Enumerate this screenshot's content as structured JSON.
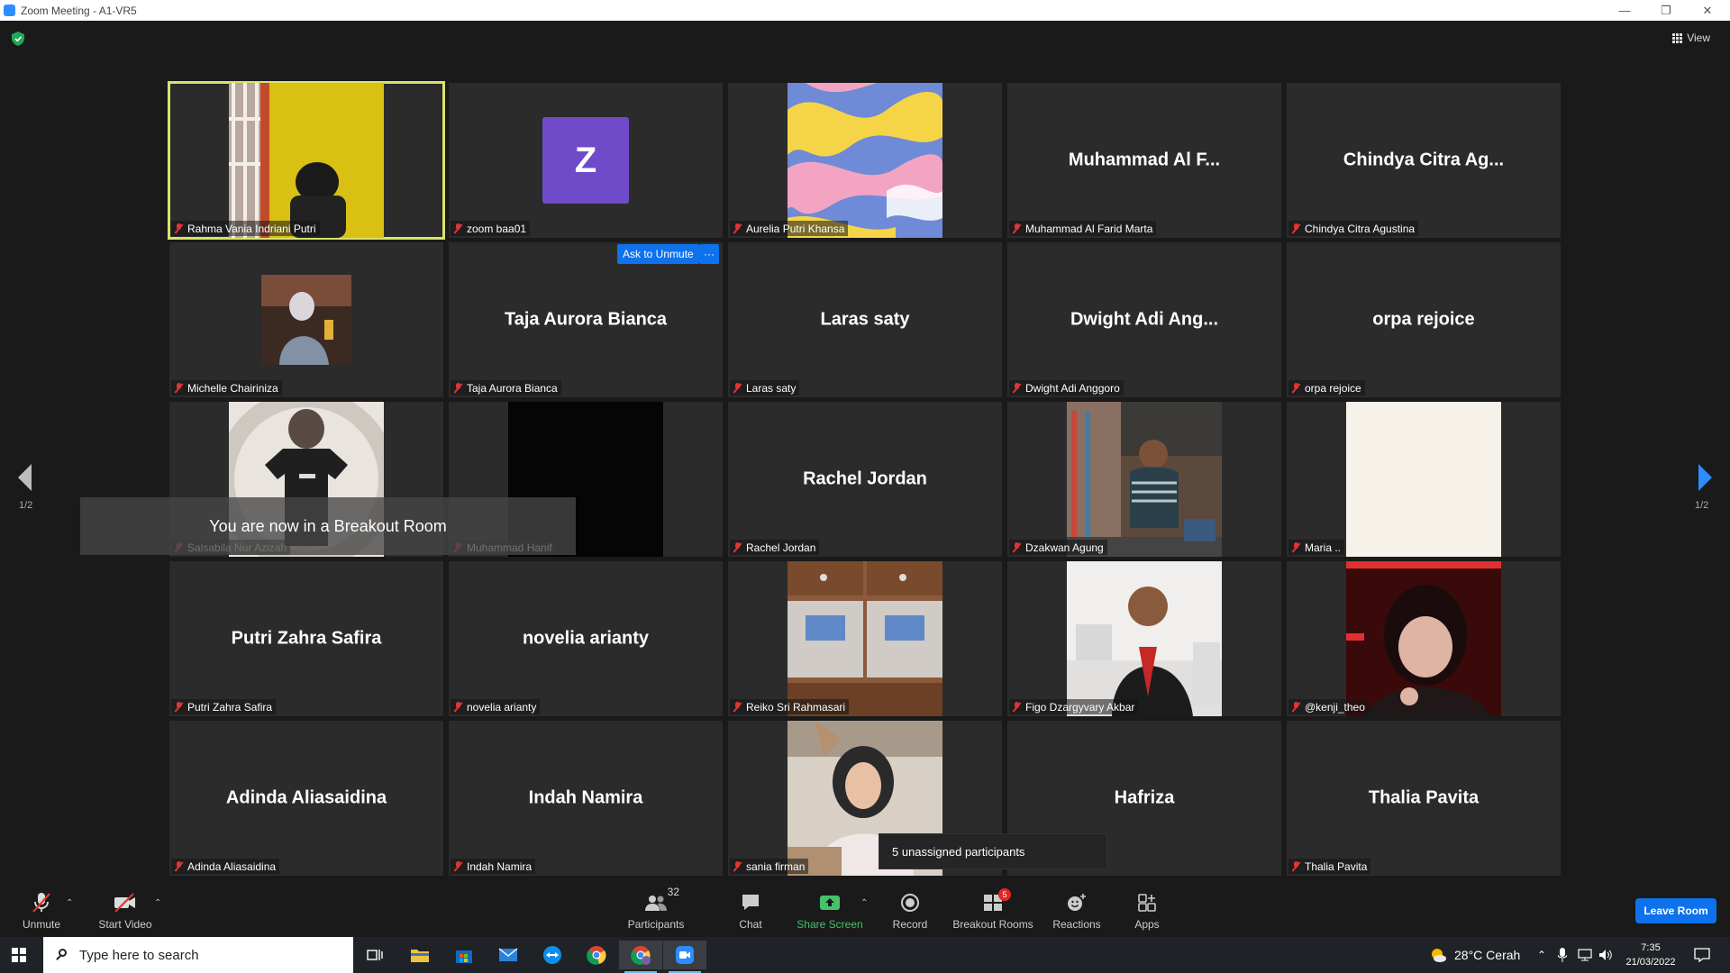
{
  "window": {
    "title": "Zoom Meeting - A1-VR5"
  },
  "view_label": "View",
  "tiles": [
    {
      "name": "Rahma Vania Indriani Putri",
      "big": "",
      "kind": "video",
      "video": "yellow"
    },
    {
      "name": "zoom baa01",
      "big": "",
      "kind": "avatar",
      "avatar_letter": "Z"
    },
    {
      "name": "Aurelia Putri Khansa",
      "big": "",
      "kind": "video",
      "video": "waves"
    },
    {
      "name": "Muhammad Al Farid Marta",
      "big": "Muhammad Al F...",
      "kind": "text"
    },
    {
      "name": "Chindya Citra Agustina",
      "big": "Chindya Citra Ag...",
      "kind": "text"
    },
    {
      "name": "Michelle Chairiniza",
      "big": "",
      "kind": "video",
      "video": "small"
    },
    {
      "name": "Taja Aurora Bianca",
      "big": "Taja Aurora Bianca",
      "kind": "text"
    },
    {
      "name": "Laras saty",
      "big": "Laras saty",
      "kind": "text"
    },
    {
      "name": "Dwight Adi Anggoro",
      "big": "Dwight Adi Ang...",
      "kind": "text"
    },
    {
      "name": "orpa rejoice",
      "big": "orpa rejoice",
      "kind": "text"
    },
    {
      "name": "Salsabila Nur Azizah",
      "big": "",
      "kind": "video",
      "video": "shirt"
    },
    {
      "name": "Muhammad Hanif",
      "big": "",
      "kind": "video",
      "video": "black"
    },
    {
      "name": "Rachel Jordan",
      "big": "Rachel Jordan",
      "kind": "text"
    },
    {
      "name": "Dzakwan Agung",
      "big": "",
      "kind": "video",
      "video": "street"
    },
    {
      "name": "Maria ..",
      "big": "",
      "kind": "video",
      "video": "cream"
    },
    {
      "name": "Putri Zahra Safira",
      "big": "Putri Zahra Safira",
      "kind": "text"
    },
    {
      "name": "novelia arianty",
      "big": "novelia arianty",
      "kind": "text"
    },
    {
      "name": "Reiko Sri Rahmasari",
      "big": "",
      "kind": "video",
      "video": "desk"
    },
    {
      "name": "Figo Dzargyvary Akbar",
      "big": "",
      "kind": "video",
      "video": "office"
    },
    {
      "name": "@kenji_theo",
      "big": "",
      "kind": "video",
      "video": "red"
    },
    {
      "name": "Adinda Aliasaidina",
      "big": "Adinda Aliasaidina",
      "kind": "text"
    },
    {
      "name": "Indah Namira",
      "big": "Indah Namira",
      "kind": "text"
    },
    {
      "name": "sania firman",
      "big": "",
      "kind": "video",
      "video": "hijab"
    },
    {
      "name": "",
      "big": "Hafriza",
      "kind": "text"
    },
    {
      "name": "Thalia Pavita",
      "big": "Thalia Pavita",
      "kind": "text"
    }
  ],
  "ask_to_unmute": "Ask to Unmute",
  "more_dots": "···",
  "breakout_toast": "You are now in a Breakout Room",
  "unassigned_popup": "5 unassigned participants",
  "page_left": "1/2",
  "page_right": "1/2",
  "toolbar": {
    "unmute": "Unmute",
    "start_video": "Start Video",
    "participants": "Participants",
    "participants_count": "32",
    "chat": "Chat",
    "share_screen": "Share Screen",
    "record": "Record",
    "breakout_rooms": "Breakout Rooms",
    "breakout_badge": "5",
    "reactions": "Reactions",
    "apps": "Apps",
    "leave_room": "Leave Room"
  },
  "taskbar": {
    "search_placeholder": "Type here to search",
    "weather": "28°C  Cerah",
    "time": "7:35",
    "date": "21/03/2022"
  },
  "colors": {
    "accent_blue": "#0e72ed",
    "active_speaker": "#d8e36a",
    "share_green": "#45c36b",
    "muted_red": "#e03535"
  }
}
